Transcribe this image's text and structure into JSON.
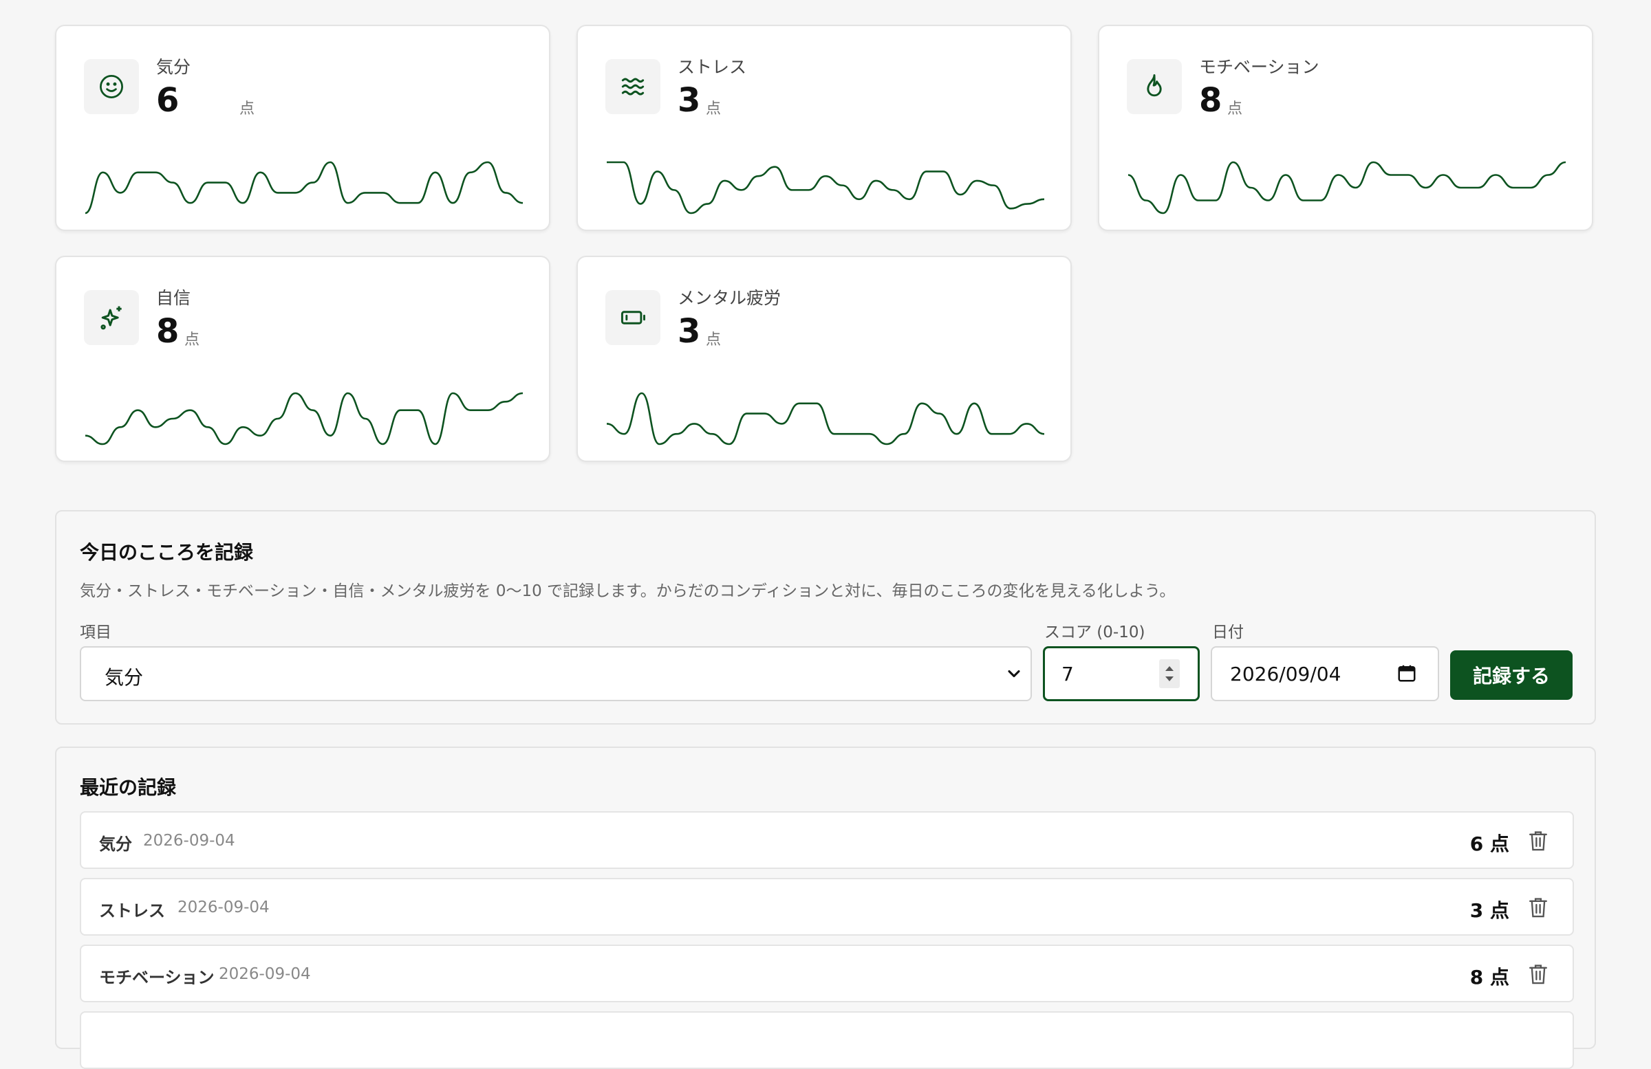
{
  "colors": {
    "accent": "#0d5320",
    "line": "#0d5320",
    "card_bg": "#ffffff",
    "page_bg": "#f6f6f6"
  },
  "cards": [
    {
      "label": "気分",
      "value": "6",
      "unit": "点",
      "icon": "smile-icon"
    },
    {
      "label": "ストレス",
      "value": "3",
      "unit": "点",
      "icon": "waves-icon"
    },
    {
      "label": "モチベーション",
      "value": "8",
      "unit": "点",
      "icon": "flame-icon"
    },
    {
      "label": "自信",
      "value": "8",
      "unit": "点",
      "icon": "sparkles-icon"
    },
    {
      "label": "メンタル疲労",
      "value": "3",
      "unit": "点",
      "icon": "battery-low-icon"
    }
  ],
  "chart_data": [
    {
      "type": "line",
      "series": [
        {
          "values": [
            5.8,
            6.2,
            6.0,
            6.2,
            6.2,
            6.1,
            5.9,
            6.1,
            6.1,
            5.9,
            6.2,
            6.0,
            6.0,
            6.1,
            6.3,
            5.9,
            6.0,
            6.0,
            5.9,
            5.9,
            6.2,
            5.9,
            6.2,
            6.3,
            6.0,
            5.9
          ]
        }
      ]
    },
    {
      "type": "line",
      "series": [
        {
          "values": [
            3.6,
            3.6,
            2.7,
            3.4,
            3.0,
            2.5,
            2.7,
            3.2,
            3.0,
            3.3,
            3.5,
            3.0,
            3.0,
            3.3,
            3.1,
            2.8,
            3.2,
            3.0,
            2.8,
            3.4,
            3.4,
            2.9,
            3.2,
            3.1,
            2.6,
            2.7,
            2.8
          ]
        }
      ]
    },
    {
      "type": "line",
      "series": [
        {
          "values": [
            8.0,
            7.8,
            7.7,
            8.0,
            7.8,
            7.8,
            8.1,
            7.9,
            7.8,
            8.0,
            7.8,
            7.8,
            8.0,
            7.9,
            8.1,
            8.0,
            8.0,
            7.9,
            8.0,
            7.9,
            7.9,
            8.0,
            7.9,
            7.9,
            8.0,
            8.1
          ]
        }
      ]
    },
    {
      "type": "line",
      "series": [
        {
          "values": [
            7.6,
            7.5,
            7.7,
            7.9,
            7.7,
            7.8,
            7.9,
            7.7,
            7.5,
            7.7,
            7.6,
            7.8,
            8.1,
            7.9,
            7.6,
            8.1,
            7.8,
            7.5,
            7.9,
            7.9,
            7.5,
            8.1,
            7.9,
            7.9,
            8.0,
            8.1
          ]
        }
      ]
    },
    {
      "type": "line",
      "series": [
        {
          "values": [
            2.9,
            2.8,
            3.2,
            2.7,
            2.8,
            2.9,
            2.8,
            2.7,
            3.0,
            3.0,
            2.9,
            3.1,
            3.1,
            2.8,
            2.8,
            2.8,
            2.7,
            2.8,
            3.1,
            3.0,
            2.8,
            3.1,
            2.8,
            2.8,
            2.9,
            2.8
          ]
        }
      ]
    }
  ],
  "form": {
    "title": "今日のこころを記録",
    "description": "気分・ストレス・モチベーション・自信・メンタル疲労を 0〜10 で記録します。からだのコンディションと対に、毎日のこころの変化を見える化しよう。",
    "item_label": "項目",
    "item_value": "気分",
    "score_label": "スコア (0-10)",
    "score_value": "7",
    "date_label": "日付",
    "date_value": "2026/09/04",
    "submit_label": "記録する"
  },
  "recent": {
    "title": "最近の記録",
    "rows": [
      {
        "metric": "気分",
        "date": "2026-09-04",
        "score": "6 点"
      },
      {
        "metric": "ストレス",
        "date": "2026-09-04",
        "score": "3 点"
      },
      {
        "metric": "モチベーション",
        "date": "2026-09-04",
        "score": "8 点"
      }
    ]
  }
}
